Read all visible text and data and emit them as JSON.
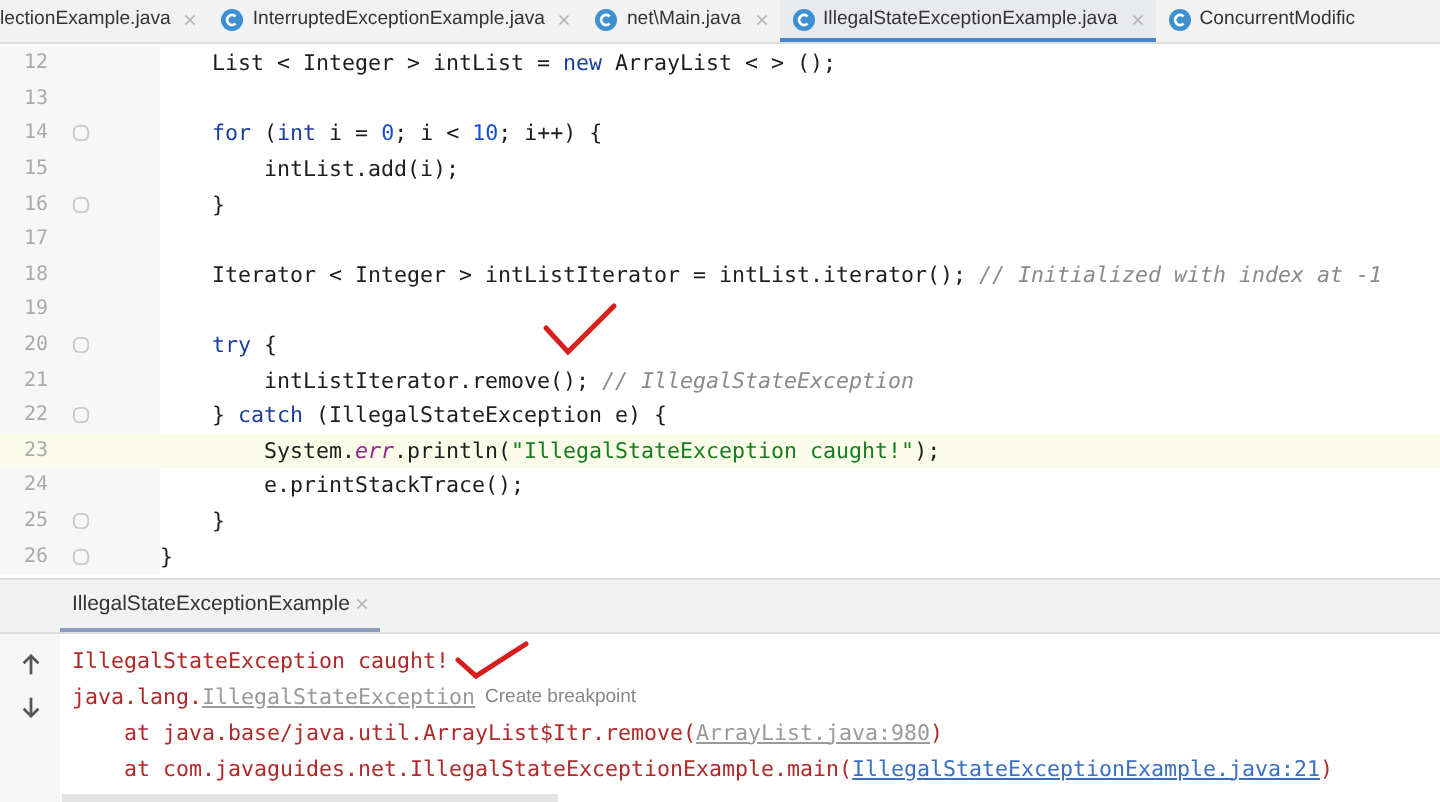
{
  "editor_tabs": [
    {
      "label": "lectionExample.java",
      "selected": false
    },
    {
      "label": "InterruptedExceptionExample.java",
      "selected": false
    },
    {
      "label": "net\\Main.java",
      "selected": false
    },
    {
      "label": "IllegalStateExceptionExample.java",
      "selected": true
    },
    {
      "label": "ConcurrentModific",
      "selected": false
    }
  ],
  "code_lines": [
    {
      "number": "12",
      "fold": false,
      "current": false,
      "tokens": [
        {
          "kind": "plain",
          "text": "    List < Integer > intList = "
        },
        {
          "kind": "keyword",
          "text": "new"
        },
        {
          "kind": "plain",
          "text": " ArrayList < > ();"
        }
      ]
    },
    {
      "number": "13",
      "fold": false,
      "current": false
    },
    {
      "number": "14",
      "fold": true,
      "current": false,
      "tokens": [
        {
          "kind": "keyword",
          "text": "    for"
        },
        {
          "kind": "plain",
          "text": " ("
        },
        {
          "kind": "keyword",
          "text": "int"
        },
        {
          "kind": "plain",
          "text": " i = "
        },
        {
          "kind": "number",
          "text": "0"
        },
        {
          "kind": "plain",
          "text": "; i < "
        },
        {
          "kind": "number",
          "text": "10"
        },
        {
          "kind": "plain",
          "text": "; i++) {"
        }
      ]
    },
    {
      "number": "15",
      "fold": false,
      "current": false,
      "tokens": [
        {
          "kind": "plain",
          "text": "        intList.add(i);"
        }
      ]
    },
    {
      "number": "16",
      "fold": true,
      "current": false,
      "tokens": [
        {
          "kind": "plain",
          "text": "    }"
        }
      ]
    },
    {
      "number": "17",
      "fold": false,
      "current": false
    },
    {
      "number": "18",
      "fold": false,
      "current": false,
      "tokens": [
        {
          "kind": "plain",
          "text": "    Iterator < Integer > intListIterator = intList.iterator(); "
        },
        {
          "kind": "comment",
          "text": "// Initialized with index at -1"
        }
      ]
    },
    {
      "number": "19",
      "fold": false,
      "current": false
    },
    {
      "number": "20",
      "fold": true,
      "current": false,
      "tokens": [
        {
          "kind": "keyword",
          "text": "    try"
        },
        {
          "kind": "plain",
          "text": " {"
        }
      ]
    },
    {
      "number": "21",
      "fold": false,
      "current": false,
      "tokens": [
        {
          "kind": "plain",
          "text": "        intListIterator.remove(); "
        },
        {
          "kind": "comment",
          "text": "// IllegalStateException"
        }
      ]
    },
    {
      "number": "22",
      "fold": true,
      "current": false,
      "tokens": [
        {
          "kind": "plain",
          "text": "    } "
        },
        {
          "kind": "keyword",
          "text": "catch"
        },
        {
          "kind": "plain",
          "text": " (IllegalStateException e) {"
        }
      ]
    },
    {
      "number": "23",
      "fold": false,
      "current": true,
      "tokens": [
        {
          "kind": "plain",
          "text": "        System."
        },
        {
          "kind": "field",
          "text": "err"
        },
        {
          "kind": "plain",
          "text": ".println("
        },
        {
          "kind": "string",
          "text": "\"IllegalStateException caught!\""
        },
        {
          "kind": "plain",
          "text": ");"
        }
      ]
    },
    {
      "number": "24",
      "fold": false,
      "current": false,
      "tokens": [
        {
          "kind": "plain",
          "text": "        e.printStackTrace();"
        }
      ]
    },
    {
      "number": "25",
      "fold": true,
      "current": false,
      "tokens": [
        {
          "kind": "plain",
          "text": "    }"
        }
      ]
    },
    {
      "number": "26",
      "fold": true,
      "current": false,
      "tokens": [
        {
          "kind": "plain",
          "text": "}"
        }
      ]
    }
  ],
  "console": {
    "tab": {
      "label": "IllegalStateExceptionExample",
      "selected": true
    },
    "lines": [
      [
        {
          "kind": "error",
          "text": "IllegalStateException caught!"
        }
      ],
      [
        {
          "kind": "error",
          "text": "java.lang."
        },
        {
          "kind": "link",
          "text": "IllegalStateException"
        },
        {
          "kind": "hint",
          "text": "Create breakpoint"
        }
      ],
      [
        {
          "kind": "error",
          "text": "    at java.base/java.util.ArrayList$Itr.remove("
        },
        {
          "kind": "link",
          "text": "ArrayList.java:980"
        },
        {
          "kind": "error",
          "text": ")"
        }
      ],
      [
        {
          "kind": "error",
          "text": "    at com.javaguides.net.IllegalStateExceptionExample.main("
        },
        {
          "kind": "source",
          "text": "IllegalStateExceptionExample.java:21"
        },
        {
          "kind": "error",
          "text": ")"
        }
      ]
    ]
  }
}
